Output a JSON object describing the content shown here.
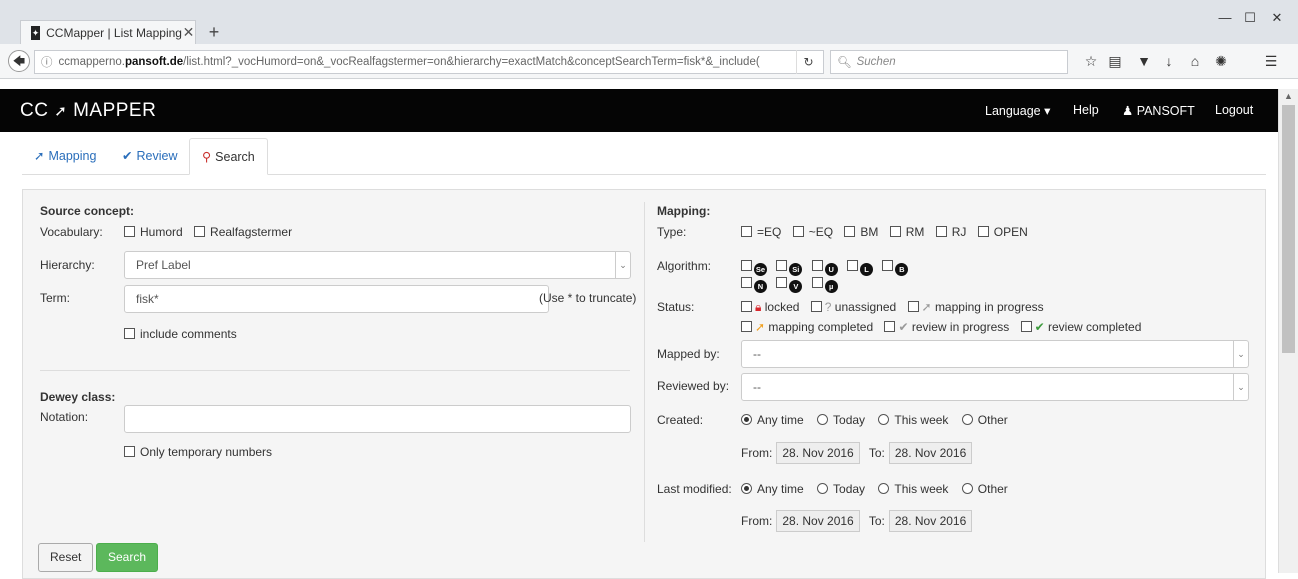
{
  "browser": {
    "tab_title": "CCMapper | List Mapping",
    "url_host": "ccmapperno.pansoft.de",
    "url_path": "/list.html?_vocHumord=on&_vocRealfagstermer=on&hierarchy=exactMatch&conceptSearchTerm=fisk*&_include(",
    "url_prefix": "ccmapperno.",
    "url_domain": "pansoft.de",
    "search_placeholder": "Suchen"
  },
  "app": {
    "brand": "CC ★ MAPPER",
    "nav": {
      "language": "Language ▾",
      "help": "Help",
      "user": "PANSOFT",
      "logout": "Logout"
    },
    "tabs": [
      {
        "label": "Mapping"
      },
      {
        "label": "Review"
      },
      {
        "label": "Search"
      }
    ]
  },
  "source": {
    "heading": "Source concept:",
    "vocab_label": "Vocabulary:",
    "vocab_options": [
      "Humord",
      "Realfagstermer"
    ],
    "hierarchy_label": "Hierarchy:",
    "hierarchy_value": "Pref Label",
    "term_label": "Term:",
    "term_value": "fisk*",
    "term_hint": "(Use * to truncate)",
    "include_comments": "include comments"
  },
  "dewey": {
    "heading": "Dewey class:",
    "notation_label": "Notation:",
    "notation_value": "",
    "temp_numbers": "Only temporary numbers"
  },
  "mapping": {
    "heading": "Mapping:",
    "type_label": "Type:",
    "types": [
      "=EQ",
      "~EQ",
      "BM",
      "RM",
      "RJ",
      "OPEN"
    ],
    "algorithm_label": "Algorithm:",
    "algorithms_row1": [
      "Se",
      "Si",
      "U",
      "L",
      "B"
    ],
    "algorithms_row2": [
      "N",
      "V",
      "µ"
    ],
    "status_label": "Status:",
    "status_row1": [
      "locked",
      "unassigned",
      "mapping in progress"
    ],
    "status_row2": [
      "mapping completed",
      "review in progress",
      "review completed"
    ],
    "mapped_by_label": "Mapped by:",
    "mapped_by_value": "--",
    "reviewed_by_label": "Reviewed by:",
    "reviewed_by_value": "--",
    "created_label": "Created:",
    "last_modified_label": "Last modified:",
    "time_options": [
      "Any time",
      "Today",
      "This week",
      "Other"
    ],
    "from_label": "From:",
    "to_label": "To:",
    "created_from": "28. Nov 2016",
    "created_to": "28. Nov 2016",
    "modified_from": "28. Nov 2016",
    "modified_to": "28. Nov 2016"
  },
  "buttons": {
    "reset": "Reset",
    "search": "Search"
  }
}
